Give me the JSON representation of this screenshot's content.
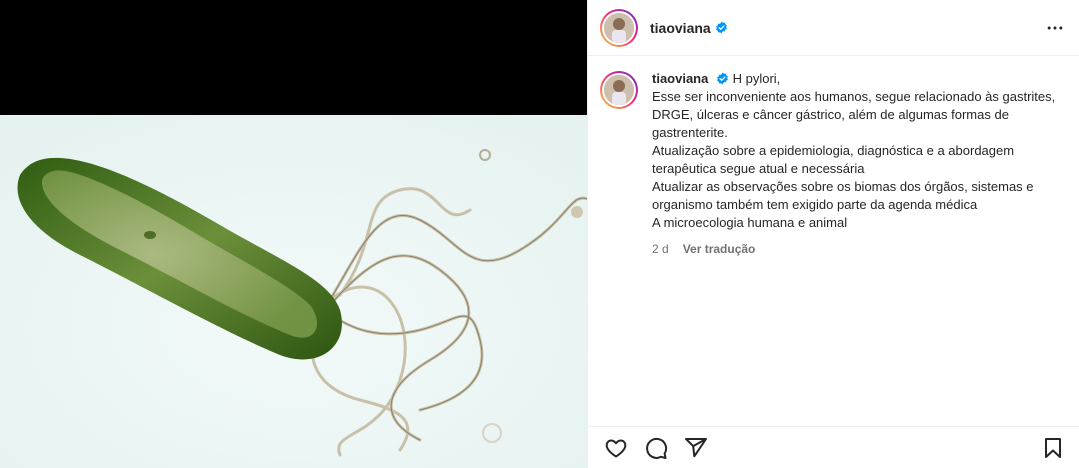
{
  "post": {
    "username": "tiaoviana",
    "verified_icon": "verified-badge-icon",
    "more_icon": "more-options-icon",
    "image_alt": "bacteria-micrograph-image"
  },
  "caption": {
    "username": "tiaoviana",
    "lines": [
      "H pylori,",
      "Esse ser inconveniente aos humanos, segue relacionado às gastrites, DRGE, úlceras e câncer gástrico, além de algumas formas de gastrenterite.",
      "Atualização sobre a epidemiologia, diagnóstica e a abordagem terapêutica segue atual e necessária",
      "Atualizar as observações sobre os biomas dos órgãos, sistemas e organismo também tem exigido parte da agenda médica",
      "A microecologia humana e animal"
    ],
    "time": "2 d",
    "translate": "Ver tradução"
  },
  "actions": {
    "like_icon": "heart-icon",
    "comment_icon": "comment-icon",
    "share_icon": "share-icon",
    "save_icon": "bookmark-icon"
  },
  "colors": {
    "verified": "#0095f6",
    "text": "#262626",
    "muted": "#737373",
    "bacteria_green": "#3f6e1c"
  }
}
